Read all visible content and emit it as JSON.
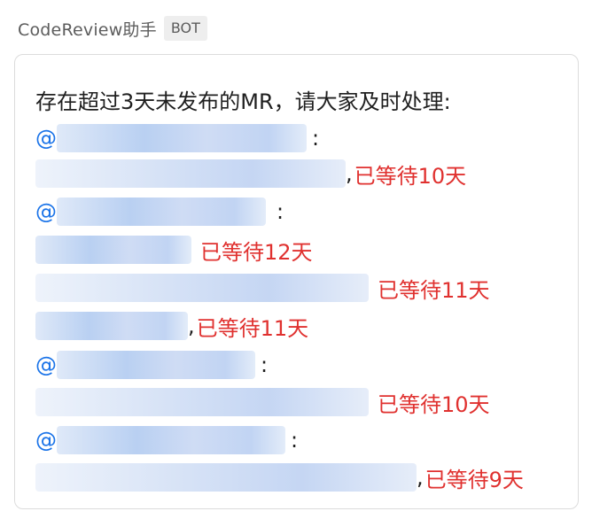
{
  "header": {
    "sender": "CodeReview助手",
    "badge": "BOT"
  },
  "message": {
    "intro": "存在超过3天未发布的MR，请大家及时处理:",
    "mentions": [
      {
        "at": "@",
        "colon": ":",
        "mrs": [
          {
            "comma": ",",
            "wait": "已等待10天"
          }
        ]
      },
      {
        "at": "@",
        "colon": ":",
        "mrs": [
          {
            "comma": "",
            "wait": "已等待12天"
          },
          {
            "comma": "",
            "wait": "已等待11天"
          },
          {
            "comma": ",",
            "wait": "已等待11天"
          }
        ]
      },
      {
        "at": "@",
        "colon": ":",
        "mrs": [
          {
            "comma": "",
            "wait": "已等待10天"
          }
        ]
      },
      {
        "at": "@",
        "colon": ":",
        "mrs": [
          {
            "comma": ",",
            "wait": "已等待9天"
          }
        ]
      }
    ]
  },
  "colors": {
    "mention": "#1a73e8",
    "wait": "#e0312f",
    "text": "#1f1f1f"
  }
}
